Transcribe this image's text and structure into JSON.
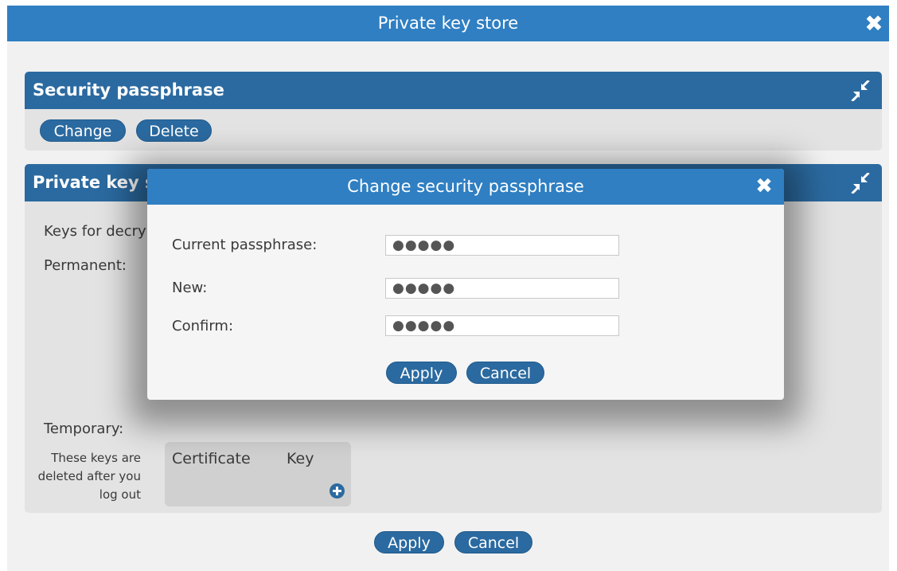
{
  "window": {
    "title": "Private key store",
    "close_icon": "close-icon"
  },
  "security_panel": {
    "title": "Security passphrase",
    "collapse_icon": "collapse-icon",
    "change_label": "Change",
    "delete_label": "Delete"
  },
  "keystore_panel": {
    "title": "Private key s",
    "collapse_icon": "collapse-icon",
    "keys_label": "Keys for decry",
    "permanent_label": "Permanent:",
    "temporary_label": "Temporary:",
    "temporary_note": "These keys are deleted after you log out",
    "columns": [
      "Certificate",
      "Key"
    ],
    "add_icon": "plus-circle-icon"
  },
  "bottom": {
    "apply_label": "Apply",
    "cancel_label": "Cancel"
  },
  "dialog": {
    "title": "Change security passphrase",
    "close_icon": "close-icon",
    "fields": [
      {
        "label": "Current passphrase:",
        "value": "●●●●●"
      },
      {
        "label": "New:",
        "value": "●●●●●"
      },
      {
        "label": "Confirm:",
        "value": "●●●●●"
      }
    ],
    "apply_label": "Apply",
    "cancel_label": "Cancel"
  },
  "colors": {
    "titlebar": "#2f7fc2",
    "panel_header": "#2b6aa0",
    "panel_body": "#e3e3e3",
    "background": "#f1f1f1"
  }
}
